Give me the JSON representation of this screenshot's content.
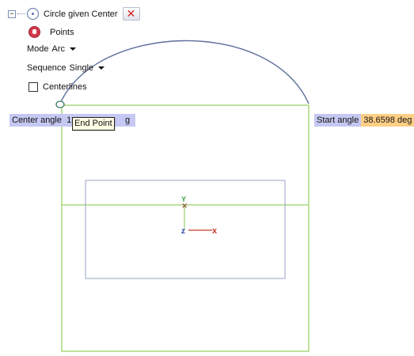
{
  "command_tree": {
    "expander_symbol": "−",
    "title": "Circle given Center",
    "points_label": "Points",
    "mode": {
      "label": "Mode",
      "value": "Arc"
    },
    "sequence": {
      "label": "Sequence",
      "value": "Single"
    },
    "centerlines": {
      "label": "Centerlines",
      "checked": false
    }
  },
  "center_angle": {
    "label": "Center angle",
    "value_visible_start": "1",
    "value_visible_end": "g"
  },
  "start_angle": {
    "label": "Start angle",
    "value": "38.6598 deg"
  },
  "tooltip": "End Point",
  "triad": {
    "y_label": "Y",
    "z_label": "z",
    "x_label": "x"
  },
  "colors": {
    "sketch_green": "#9bd26a",
    "arc_blue": "#5d6e9c",
    "frame_blue": "#9aa3c9",
    "label_bg": "#c5c8f2",
    "start_value_bg": "#ffcf85",
    "cancel_red": "#d2232a",
    "axis_x": "#c23a2a",
    "axis_y": "#3f9a4a",
    "axis_z": "#2d3fa8"
  }
}
